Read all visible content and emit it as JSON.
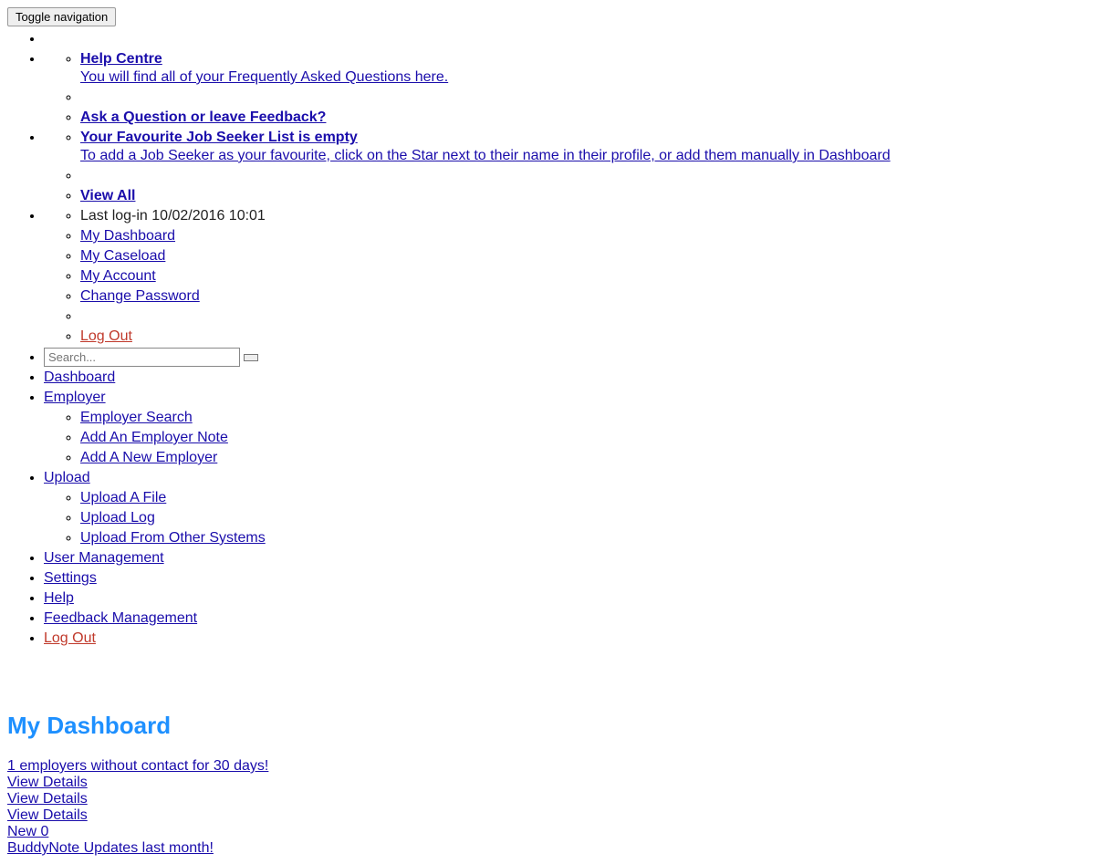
{
  "toggle_label": "Toggle navigation",
  "topnav": {
    "help_centre": {
      "title": "Help Centre",
      "subtitle": "You will find all of your Frequently Asked Questions here.",
      "ask": "Ask a Question or leave Feedback?"
    },
    "favourites": {
      "title": "Your Favourite Job Seeker List is empty",
      "subtitle": "To add a Job Seeker as your favourite, click on the Star next to their name in their profile, or add them manually in Dashboard",
      "view_all": "View All"
    },
    "account": {
      "last_login": "Last log-in 10/02/2016 10:01",
      "my_dashboard": "My Dashboard",
      "my_caseload": "My Caseload",
      "my_account": "My Account",
      "change_password": "Change Password",
      "log_out": "Log Out"
    }
  },
  "search": {
    "placeholder": "Search..."
  },
  "mainnav": {
    "dashboard": "Dashboard",
    "employer": {
      "label": "Employer",
      "search": "Employer Search",
      "add_note": "Add An Employer Note",
      "add_new": "Add A New Employer"
    },
    "upload": {
      "label": "Upload",
      "file": "Upload A File",
      "log": "Upload Log",
      "other": "Upload From Other Systems"
    },
    "user_mgmt": "User Management",
    "settings": "Settings",
    "help": "Help",
    "feedback_mgmt": "Feedback Management",
    "log_out": "Log Out"
  },
  "page": {
    "title": "My Dashboard",
    "alert_employers": "1 employers without contact for 30 days!",
    "view_details": "View Details",
    "new_label": "New ",
    "new_count": "0",
    "buddy": "BuddyNote Updates last month!"
  }
}
